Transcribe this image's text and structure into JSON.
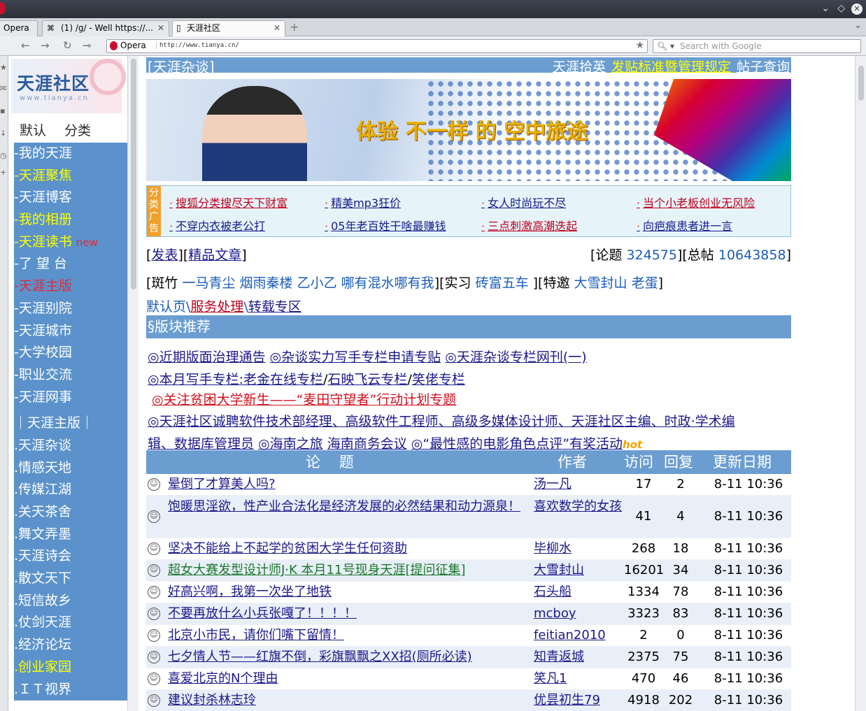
{
  "browser": {
    "tabs": [
      {
        "label": "Opera"
      },
      {
        "label": "(1) /g/ - Well https://..."
      },
      {
        "label": "天涯社区"
      }
    ],
    "opera_badge": "Opera",
    "url": "http://www.tianya.cn/",
    "search_placeholder": "Search with Google"
  },
  "sidebar": {
    "logo_text": "天涯社区",
    "logo_sub": "www.tianya.cn",
    "menu_head": "默认 分类",
    "items": [
      {
        "label": "-我的天涯"
      },
      {
        "label": "-天涯聚焦"
      },
      {
        "label": "-天涯博客"
      },
      {
        "label": "-我的相册"
      },
      {
        "label": "-天涯读书",
        "badge": "new"
      },
      {
        "label": "-了 望 台"
      },
      {
        "label": "-天涯主版"
      },
      {
        "label": "-天涯别院"
      },
      {
        "label": "-天涯城市"
      },
      {
        "label": "-大学校园"
      },
      {
        "label": "-职业交流"
      },
      {
        "label": "-天涯网事"
      },
      {
        "label": " ｜天涯主版｜"
      },
      {
        "label": " .天涯杂谈"
      },
      {
        "label": " .情感天地"
      },
      {
        "label": " .传媒江湖"
      },
      {
        "label": " .关天茶舍"
      },
      {
        "label": " .舞文弄墨"
      },
      {
        "label": " .天涯诗会"
      },
      {
        "label": " .散文天下"
      },
      {
        "label": " .短信故乡"
      },
      {
        "label": " .仗剑天涯"
      },
      {
        "label": " .经济论坛"
      },
      {
        "label": " .创业家园"
      },
      {
        "label": " .ＩＴ视界"
      }
    ]
  },
  "board": {
    "name": "[天涯杂谈]",
    "links": [
      "天涯拾英",
      "发贴标准暨管理规定",
      "帖子查询"
    ],
    "banner_slogan": "体验 不一样 的 空中旅途",
    "ad_tag": "分类广告",
    "ads": [
      "搜狐分类搜尽天下财富",
      "精美mp3狂价",
      "女人时尚玩不尽",
      "当个小老板创业无风险",
      "不穿内衣被老公打",
      "05年老百姓干啥最赚钱",
      "三点刺激高潮迭起",
      "向疤痕患者进一言"
    ],
    "actions": {
      "post": "发表",
      "elite": "精品文章"
    },
    "stats": {
      "topics_label": "论题",
      "topics": "324575",
      "posts_label": "总帖",
      "posts": "10643858"
    },
    "moderators": {
      "label_mod": "斑竹",
      "mods": [
        "一马青尘",
        "烟雨秦楼",
        "乙小乙",
        "哪有混水哪有我"
      ],
      "label_intern": "实习",
      "interns": [
        "砖富五车"
      ],
      "label_guest": "特邀",
      "guests": [
        "大雪封山",
        "老蛋"
      ]
    },
    "crumb": {
      "home": "默认页",
      "service": "服务处理",
      "repost": "转载专区"
    },
    "section_title": "§版块推荐",
    "recs": {
      "l1a": "◎近期版面治理通告",
      "l1b": "◎杂谈实力写手专栏申请专贴",
      "l1c": "◎天涯杂谈专栏网刊(一)",
      "l2a": "◎本月写手专栏:老金在线专栏",
      "l2b": "石映飞云专栏",
      "l2c": "笑佬专栏",
      "l3": "◎关注贫困大学新生——“麦田守望者”行动计划专题",
      "l4": "◎天涯社区诚聘软件技术部经理、高级软件工程师、高级多媒体设计师、天涯社区主编、时政·学术编",
      "l5a": "辑、数据库管理员",
      "l5b": "◎海南之旅",
      "l5c": "海南商务会议",
      "l5d": "◎“最性感的电影角色点评”有奖活动",
      "hot": "hot"
    },
    "table": {
      "headers": {
        "topic": "论    题",
        "author": "作者",
        "visits": "访问",
        "replies": "回复",
        "updated": "更新日期"
      },
      "rows": [
        {
          "title": "晕倒了才算美人吗?",
          "author": "汤一凡",
          "visits": "17",
          "replies": "2",
          "date": "8-11 10:36"
        },
        {
          "title": "饱暖思淫欲，性产业合法化是经济发展的必然结果和动力源泉！",
          "author": "喜欢数学的女孩",
          "visits": "41",
          "replies": "4",
          "date": "8-11 10:36"
        },
        {
          "title": "坚决不能给上不起学的贫困大学生任何资助",
          "author": "毕柳水",
          "visits": "268",
          "replies": "18",
          "date": "8-11 10:36"
        },
        {
          "title": "超女大赛发型设计师J·K 本月11号现身天涯[提问征集]",
          "author": "大雪封山",
          "visits": "16201",
          "replies": "34",
          "date": "8-11 10:36"
        },
        {
          "title": "好高兴啊，我第一次坐了地铁",
          "author": "石头船",
          "visits": "1334",
          "replies": "78",
          "date": "8-11 10:36"
        },
        {
          "title": "不要再放什么小兵张嘎了！！！！",
          "author": "mcboy",
          "visits": "3323",
          "replies": "83",
          "date": "8-11 10:36"
        },
        {
          "title": "北京小市民，请你们嘴下留情！",
          "author": "feitian2010",
          "visits": "2",
          "replies": "0",
          "date": "8-11 10:36"
        },
        {
          "title": "七夕情人节——红旗不倒，彩旗飘飘之XX招(厕所必读)",
          "author": "知青返城",
          "visits": "2375",
          "replies": "75",
          "date": "8-11 10:36"
        },
        {
          "title": "喜爱北京的N个理由",
          "author": "笑凡1",
          "visits": "470",
          "replies": "46",
          "date": "8-11 10:36"
        },
        {
          "title": "建议封杀林志玲",
          "author": "优昙初生79",
          "visits": "4918",
          "replies": "202",
          "date": "8-11 10:36"
        }
      ]
    }
  }
}
